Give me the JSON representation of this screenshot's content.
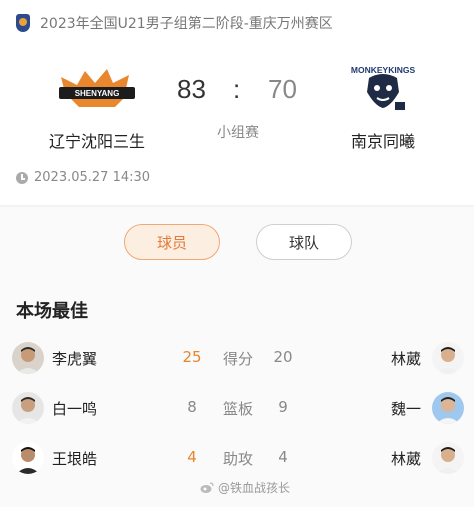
{
  "match": {
    "league_title": "2023年全国U21男子组第二阶段-重庆万州赛区",
    "home_team": "辽宁沈阳三生",
    "away_team": "南京同曦",
    "home_score": "83",
    "separator": ":",
    "away_score": "70",
    "stage": "小组赛",
    "datetime": "2023.05.27 14:30",
    "home_logo_text": "SHENYANG",
    "away_logo_text": "MONKEYKINGS"
  },
  "tabs": {
    "players": "球员",
    "teams": "球队"
  },
  "best": {
    "title": "本场最佳",
    "rows": [
      {
        "left_player": "李虎翼",
        "left_value": "25",
        "stat": "得分",
        "right_value": "20",
        "right_player": "林葳"
      },
      {
        "left_player": "白一鸣",
        "left_value": "8",
        "stat": "篮板",
        "right_value": "9",
        "right_player": "魏一"
      },
      {
        "left_player": "王垠皓",
        "left_value": "4",
        "stat": "助攻",
        "right_value": "4",
        "right_player": "林葳"
      }
    ]
  },
  "watermark": "@铁血战孩长",
  "colors": {
    "accent": "#e27b3a",
    "lead_value": "#e6872f",
    "muted": "#888888"
  }
}
